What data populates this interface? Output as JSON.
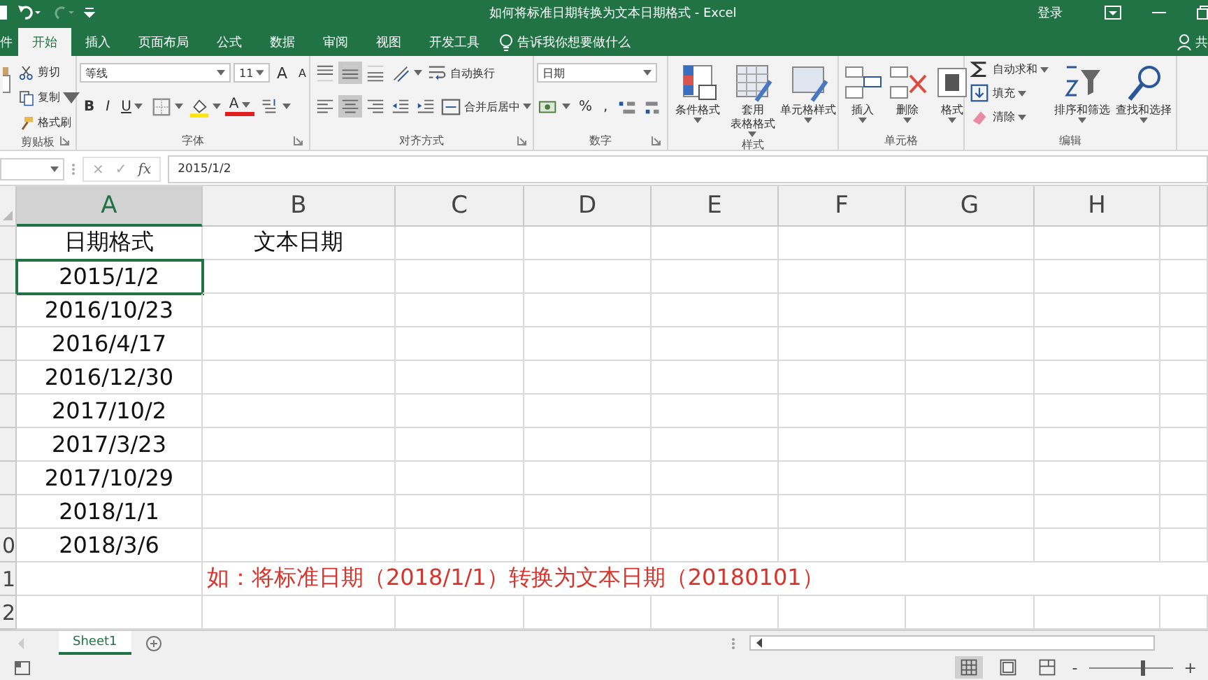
{
  "title_bar": {
    "title": "如何将标准日期转换为文本日期格式 - Excel",
    "login": "登录"
  },
  "tabs": [
    {
      "label": "件",
      "selected": false
    },
    {
      "label": "开始",
      "selected": true
    },
    {
      "label": "插入",
      "selected": false
    },
    {
      "label": "页面布局",
      "selected": false
    },
    {
      "label": "公式",
      "selected": false
    },
    {
      "label": "数据",
      "selected": false
    },
    {
      "label": "审阅",
      "selected": false
    },
    {
      "label": "视图",
      "selected": false
    },
    {
      "label": "开发工具",
      "selected": false
    }
  ],
  "tell_me": "告诉我你想要做什么",
  "share": "共",
  "ribbon": [
    {
      "kind": "clipboard",
      "name": "剪贴板",
      "launcher": true,
      "items": [
        {
          "kind": "stack",
          "rows": [
            [
              {
                "kind": "cut",
                "label": "剪切"
              }
            ],
            [
              {
                "kind": "copy",
                "label": "复制",
                "dropdown": true
              }
            ],
            [
              {
                "kind": "painter",
                "label": "格式刷"
              }
            ]
          ]
        }
      ]
    },
    {
      "kind": "font",
      "name": "字体",
      "launcher": true,
      "items": [
        {
          "kind": "stack",
          "rows": [
            [
              {
                "kind": "font-field",
                "value": "等线"
              },
              {
                "kind": "size-field",
                "value": "11"
              },
              {
                "kind": "grow",
                "label": "A"
              },
              {
                "kind": "shrink",
                "label": "A"
              }
            ],
            [
              {
                "kind": "bold",
                "label": "B"
              },
              {
                "kind": "italic",
                "label": "I"
              },
              {
                "kind": "underline",
                "label": "U",
                "dropdown": true
              },
              {
                "kind": "borders",
                "dropdown": true
              },
              {
                "kind": "fill",
                "dropdown": true
              },
              {
                "kind": "font-color",
                "label": "A",
                "dropdown": true
              },
              {
                "kind": "phonetic",
                "dropdown": true
              }
            ]
          ]
        }
      ]
    },
    {
      "kind": "alignment",
      "name": "对齐方式",
      "launcher": true,
      "items": [
        {
          "kind": "stack",
          "rows": [
            [
              {
                "kind": "align-top",
                "pressed": false
              },
              {
                "kind": "align-middle",
                "pressed": true
              },
              {
                "kind": "align-bottom",
                "pressed": false
              },
              {
                "kind": "orient",
                "dropdown": true
              },
              {
                "kind": "wrap",
                "label": "自动换行"
              }
            ],
            [
              {
                "kind": "align-left",
                "pressed": false
              },
              {
                "kind": "align-center",
                "pressed": true
              },
              {
                "kind": "align-right",
                "pressed": false
              },
              {
                "kind": "outdent"
              },
              {
                "kind": "indent"
              },
              {
                "kind": "merge",
                "label": "合并后居中",
                "dropdown": true
              }
            ]
          ]
        }
      ]
    },
    {
      "kind": "number",
      "name": "数字",
      "launcher": true,
      "items": [
        {
          "kind": "stack",
          "rows": [
            [
              {
                "kind": "number-field",
                "value": "日期"
              }
            ],
            [
              {
                "kind": "currency",
                "dropdown": true
              },
              {
                "kind": "percent",
                "label": "%"
              },
              {
                "kind": "comma",
                "label": ","
              },
              {
                "kind": "inc-decimal"
              },
              {
                "kind": "dec-decimal"
              }
            ]
          ]
        }
      ]
    },
    {
      "kind": "styles",
      "name": "样式",
      "items": [
        {
          "kind": "cond-format",
          "lines": [
            "条件格式"
          ],
          "dropdown": true
        },
        {
          "kind": "table-format",
          "lines": [
            "套用",
            "表格格式"
          ],
          "dropdown": true
        },
        {
          "kind": "cell-style",
          "lines": [
            "单元格样式"
          ],
          "dropdown": true
        }
      ]
    },
    {
      "kind": "cells",
      "name": "单元格",
      "items": [
        {
          "kind": "insert",
          "lines": [
            "插入"
          ],
          "dropdown": true
        },
        {
          "kind": "delete",
          "lines": [
            "删除"
          ],
          "dropdown": true
        },
        {
          "kind": "format",
          "lines": [
            "格式"
          ],
          "dropdown": true
        }
      ]
    },
    {
      "kind": "editing",
      "name": "编辑",
      "items": [
        {
          "kind": "stack",
          "rows": [
            [
              {
                "kind": "autosum",
                "label": "自动求和",
                "dropdown": true
              }
            ],
            [
              {
                "kind": "fill-down",
                "label": "填充",
                "dropdown": true
              }
            ],
            [
              {
                "kind": "clear",
                "label": "清除",
                "dropdown": true
              }
            ]
          ]
        },
        {
          "kind": "sort",
          "lines": [
            "排序和筛选"
          ],
          "dropdown": true
        },
        {
          "kind": "find",
          "lines": [
            "查找和选择"
          ],
          "dropdown": true
        }
      ]
    }
  ],
  "formula_bar": {
    "cancel": "×",
    "enter": "✓",
    "fx": "fx",
    "value": "2015/1/2"
  },
  "columns": [
    {
      "label": "A",
      "selected": true
    },
    {
      "label": "B",
      "selected": false
    },
    {
      "label": "C",
      "selected": false
    },
    {
      "label": "D",
      "selected": false
    },
    {
      "label": "E",
      "selected": false
    },
    {
      "label": "F",
      "selected": false
    },
    {
      "label": "G",
      "selected": false
    },
    {
      "label": "H",
      "selected": false
    }
  ],
  "rows": [
    {
      "cells": [
        {
          "text": "日期格式",
          "selected": false
        },
        {
          "text": "文本日期",
          "selected": false
        }
      ]
    },
    {
      "cells": [
        {
          "text": "2015/1/2",
          "selected": true
        }
      ]
    },
    {
      "cells": [
        {
          "text": "2016/10/23",
          "selected": false
        }
      ]
    },
    {
      "cells": [
        {
          "text": "2016/4/17",
          "selected": false
        }
      ]
    },
    {
      "cells": [
        {
          "text": "2016/12/30",
          "selected": false
        }
      ]
    },
    {
      "cells": [
        {
          "text": "2017/10/2",
          "selected": false
        }
      ]
    },
    {
      "cells": [
        {
          "text": "2017/3/23",
          "selected": false
        }
      ]
    },
    {
      "cells": [
        {
          "text": "2017/10/29",
          "selected": false
        }
      ]
    },
    {
      "cells": [
        {
          "text": "2018/1/1",
          "selected": false
        }
      ]
    },
    {
      "number": "0",
      "cells": [
        {
          "text": "2018/3/6",
          "selected": false
        }
      ]
    },
    {
      "number": "1",
      "cells": [],
      "note": "如：将标准日期（2018/1/1）转换为文本日期（20180101）"
    },
    {
      "number": "2",
      "cells": []
    }
  ],
  "sheets": [
    {
      "label": "Sheet1",
      "selected": true
    }
  ],
  "status_bar": {
    "views": [
      {
        "kind": "normal",
        "selected": true
      },
      {
        "kind": "page-layout",
        "selected": false
      },
      {
        "kind": "page-break",
        "selected": false
      }
    ],
    "zoom_out": "-",
    "zoom_in": "+",
    "zoom": {
      "level": 0.62
    }
  }
}
